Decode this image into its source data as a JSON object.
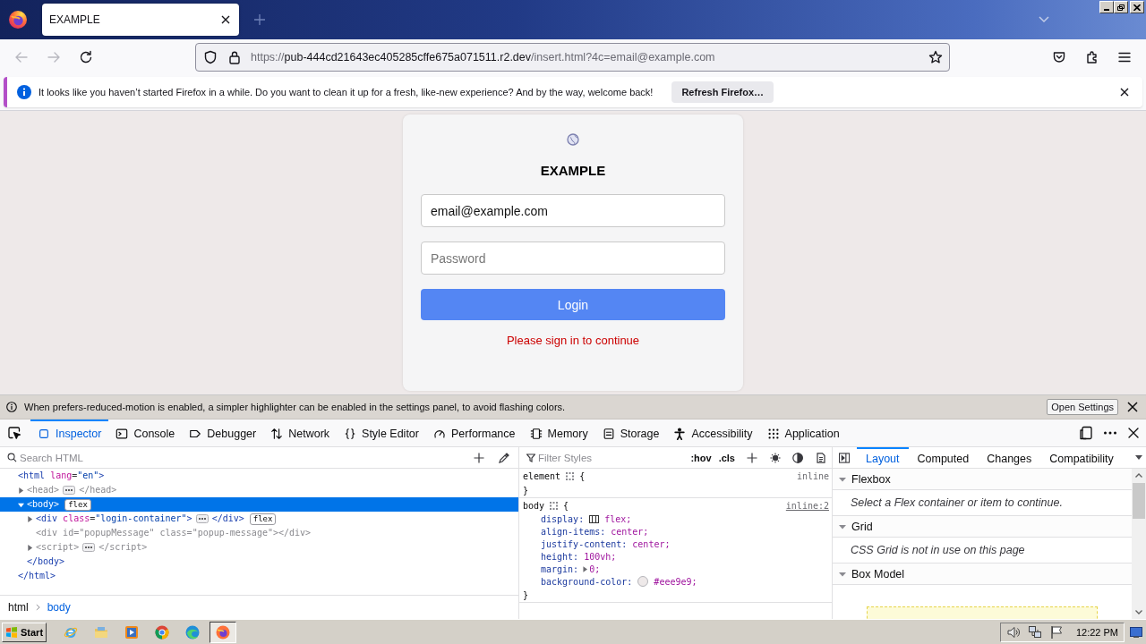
{
  "browser": {
    "tabs": [
      {
        "title": "EXAMPLE",
        "selected": true
      }
    ],
    "navigation": {
      "back_disabled": true,
      "forward_disabled": true
    },
    "address": {
      "scheme": "https://",
      "host": "pub-444cd21643ec405285cffe675a071511.r2.dev",
      "path": "/insert.html?4c=email@example.com"
    },
    "notification": {
      "text": "It looks like you haven’t started Firefox in a while. Do you want to clean it up for a fresh, like-new experience? And by the way, welcome back!",
      "button": "Refresh Firefox…"
    }
  },
  "page": {
    "title": "EXAMPLE",
    "email": {
      "value": "email@example.com"
    },
    "password": {
      "placeholder": "Password"
    },
    "button": "Login",
    "message": "Please sign in to continue"
  },
  "devtools": {
    "notice": {
      "text": "When prefers-reduced-motion is enabled, a simpler highlighter can be enabled in the settings panel, to avoid flashing colors.",
      "button": "Open Settings"
    },
    "tabs": [
      {
        "kind": "inspector",
        "label": "Inspector",
        "selected": true
      },
      {
        "kind": "console",
        "label": "Console",
        "selected": false
      },
      {
        "kind": "debugger",
        "label": "Debugger",
        "selected": false
      },
      {
        "kind": "network",
        "label": "Network",
        "selected": false
      },
      {
        "kind": "editor",
        "label": "Style Editor",
        "selected": false
      },
      {
        "kind": "performance",
        "label": "Performance",
        "selected": false
      },
      {
        "kind": "memory",
        "label": "Memory",
        "selected": false
      },
      {
        "kind": "storage",
        "label": "Storage",
        "selected": false
      },
      {
        "kind": "accessibility",
        "label": "Accessibility",
        "selected": false
      },
      {
        "kind": "application",
        "label": "Application",
        "selected": false
      }
    ],
    "markup": {
      "search": {
        "placeholder": "Search HTML"
      },
      "nodes": [
        {
          "parts": [
            {
              "kind": "tag",
              "text": "<html"
            },
            {
              "kind": "attr",
              "text": " lang"
            },
            {
              "kind": "punct",
              "text": "="
            },
            {
              "kind": "value",
              "text": "\"en\""
            },
            {
              "kind": "tag",
              "text": ">"
            }
          ],
          "selected": false,
          "dimmed": false,
          "close": "</html>",
          "children": [
            {
              "parts": [
                {
                  "kind": "tag",
                  "text": "<head>"
                }
              ],
              "expanded": false,
              "selected": false,
              "dimmed": true,
              "collapsed_close": "</head>"
            },
            {
              "parts": [
                {
                  "kind": "tag",
                  "text": "<body>"
                }
              ],
              "badge": "flex",
              "expanded": true,
              "selected": true,
              "dimmed": false,
              "close": "</body>",
              "children": [
                {
                  "parts": [
                    {
                      "kind": "tag",
                      "text": "<div"
                    },
                    {
                      "kind": "attr",
                      "text": " class"
                    },
                    {
                      "kind": "punct",
                      "text": "="
                    },
                    {
                      "kind": "value",
                      "text": "\"login-container\""
                    },
                    {
                      "kind": "tag",
                      "text": ">"
                    }
                  ],
                  "expanded": false,
                  "selected": false,
                  "dimmed": false,
                  "collapsed_close": "</div>",
                  "badge": "flex"
                },
                {
                  "parts": [
                    {
                      "kind": "tag",
                      "text": "<div"
                    },
                    {
                      "kind": "attr",
                      "text": " id"
                    },
                    {
                      "kind": "punct",
                      "text": "="
                    },
                    {
                      "kind": "value",
                      "text": "\"popupMessage\""
                    },
                    {
                      "kind": "attr",
                      "text": " class"
                    },
                    {
                      "kind": "punct",
                      "text": "="
                    },
                    {
                      "kind": "value",
                      "text": "\"popup-message\""
                    },
                    {
                      "kind": "tag",
                      "text": "></div>"
                    }
                  ],
                  "selected": false,
                  "dimmed": true
                },
                {
                  "parts": [
                    {
                      "kind": "tag",
                      "text": "<script>"
                    }
                  ],
                  "expanded": false,
                  "selected": false,
                  "dimmed": true,
                  "collapsed_close": "</script>"
                }
              ]
            }
          ]
        }
      ],
      "breadcrumbs": [
        {
          "label": "html",
          "selected": false
        },
        {
          "label": "body",
          "selected": true
        }
      ]
    },
    "rules": {
      "filter": {
        "placeholder": "Filter Styles"
      },
      "hover_toggle": ":hov",
      "class_toggle": ".cls",
      "items": [
        {
          "selector": "element",
          "open": "{",
          "source": "inline",
          "linked": false,
          "close": "}"
        },
        {
          "selector": "body",
          "open": "{",
          "source": "inline:2",
          "linked": true,
          "close": "}",
          "declarations": [
            {
              "kind": "flex",
              "name": "display:",
              "value": "flex;"
            },
            {
              "kind": "plain",
              "name": "align-items:",
              "value": "center;"
            },
            {
              "kind": "plain",
              "name": "justify-content:",
              "value": "center;"
            },
            {
              "kind": "plain",
              "name": "height:",
              "value": "100vh;"
            },
            {
              "kind": "shorthand",
              "name": "margin:",
              "value": "0;"
            },
            {
              "kind": "color",
              "name": "background-color:",
              "value": "#eee9e9;",
              "color": "#eee9e9"
            }
          ]
        }
      ]
    },
    "sidebar": {
      "tabs": [
        {
          "label": "Layout",
          "selected": true
        },
        {
          "label": "Computed",
          "selected": false
        },
        {
          "label": "Changes",
          "selected": false
        },
        {
          "label": "Compatibility",
          "selected": false
        }
      ],
      "sections": [
        {
          "kind": "flexbox",
          "title": "Flexbox",
          "expanded": true,
          "message": "Select a Flex container or item to continue."
        },
        {
          "kind": "grid",
          "title": "Grid",
          "expanded": true,
          "message": "CSS Grid is not in use on this page"
        },
        {
          "kind": "boxmodel",
          "title": "Box Model",
          "expanded": true
        }
      ]
    }
  },
  "taskbar": {
    "start": "Start",
    "apps": [
      {
        "kind": "orbit",
        "selected": false
      },
      {
        "kind": "folder",
        "selected": false
      },
      {
        "kind": "player",
        "selected": false
      },
      {
        "kind": "circle",
        "selected": false
      },
      {
        "kind": "swirl",
        "selected": false
      },
      {
        "kind": "flame",
        "selected": true
      }
    ],
    "clock": "12:22 PM"
  }
}
